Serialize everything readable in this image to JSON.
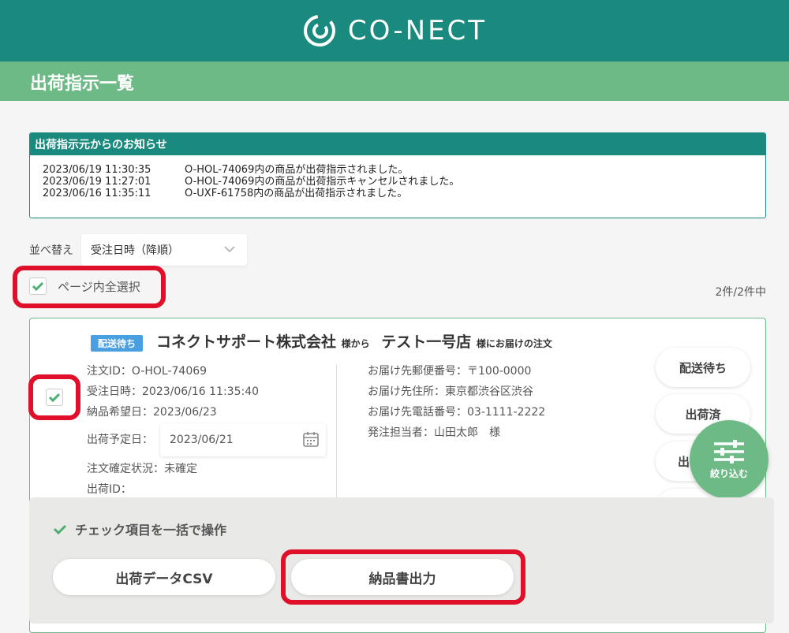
{
  "header": {
    "brand": "CO-NECT"
  },
  "page": {
    "title": "出荷指示一覧"
  },
  "notice": {
    "heading": "出荷指示元からのお知らせ",
    "items": [
      {
        "time": "2023/06/19 11:30:35",
        "message": "O-HOL-74069内の商品が出荷指示されました。"
      },
      {
        "time": "2023/06/19 11:27:01",
        "message": "O-HOL-74069内の商品が出荷指示キャンセルされました。"
      },
      {
        "time": "2023/06/16 11:35:11",
        "message": "O-UXF-61758内の商品が出荷指示されました。"
      }
    ]
  },
  "sort": {
    "label": "並べ替え",
    "value": "受注日時（降順）"
  },
  "select_all": {
    "label": "ページ内全選択",
    "checked": true
  },
  "result_count": "2件/2件中",
  "order": {
    "badge": "配送待ち",
    "from_company": "コネクトサポート株式会社",
    "from_suffix": "様から",
    "to_store": "テスト一号店",
    "to_suffix": "様にお届けの注文",
    "checked": true,
    "order_id": "注文ID：O-HOL-74069",
    "order_date": "受注日時：2023/06/16 11:35:40",
    "desired_date": "納品希望日：2023/06/23",
    "ship_date_label": "出荷予定日：",
    "ship_date_value": "2023/06/21",
    "confirm_status": "注文確定状況：未確定",
    "shipment_id": "出荷ID：",
    "postal": "お届け先郵便番号：〒100-0000",
    "address": "お届け先住所：東京都渋谷区渋谷",
    "phone": "お届け先電話番号：03-1111-2222",
    "contact": "発注担当者：山田太郎　様",
    "status_buttons": [
      "配送待ち",
      "出荷済",
      "出"
    ]
  },
  "filter_button": {
    "label": "絞り込む"
  },
  "bulk": {
    "title": "チェック項目を一括で操作",
    "csv_button": "出荷データCSV",
    "invoice_button": "納品書出力"
  },
  "colors": {
    "brand": "#1a8a7e",
    "accent": "#6dba86",
    "badge": "#4a9fe0",
    "highlight": "#e0102a"
  }
}
